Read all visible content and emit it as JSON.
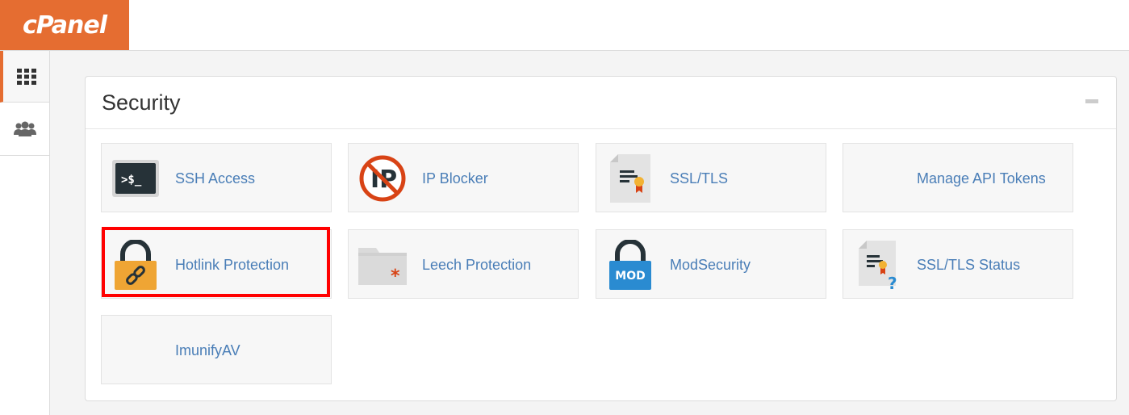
{
  "header": {
    "logo_text": "cPanel"
  },
  "sidebar": {
    "items": [
      {
        "icon": "grid-icon",
        "active": true
      },
      {
        "icon": "users-icon",
        "active": false
      }
    ]
  },
  "section": {
    "title": "Security",
    "tools": [
      {
        "label": "SSH Access",
        "icon": "terminal-icon"
      },
      {
        "label": "IP Blocker",
        "icon": "ip-blocked-icon"
      },
      {
        "label": "SSL/TLS",
        "icon": "certificate-icon"
      },
      {
        "label": "Manage API Tokens",
        "icon": ""
      },
      {
        "label": "Hotlink Protection",
        "icon": "padlock-link-icon",
        "highlighted": true
      },
      {
        "label": "Leech Protection",
        "icon": "folder-asterisk-icon"
      },
      {
        "label": "ModSecurity",
        "icon": "padlock-mod-icon",
        "badge": "MOD"
      },
      {
        "label": "SSL/TLS Status",
        "icon": "certificate-question-icon"
      },
      {
        "label": "ImunifyAV",
        "icon": ""
      }
    ]
  },
  "colors": {
    "brand": "#e56d31",
    "link": "#4a7eb7",
    "highlight": "#ff0000"
  }
}
